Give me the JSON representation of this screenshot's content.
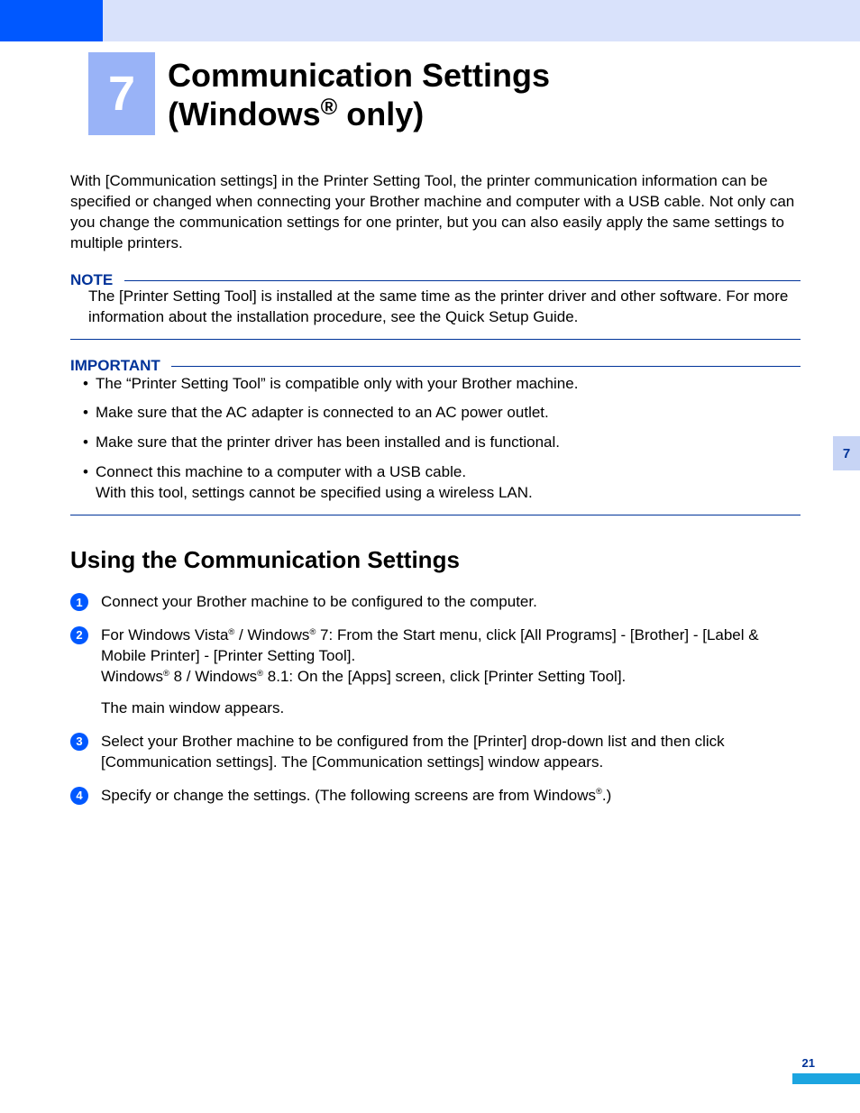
{
  "chapter": {
    "number": "7",
    "title_line1": "Communication Settings",
    "title_line2_a": "(Windows",
    "title_line2_b": " only)"
  },
  "intro": "With [Communication settings] in the Printer Setting Tool, the printer communication information can be specified or changed when connecting your Brother machine and computer with a USB cable. Not only can you change the communication settings for one printer, but you can also easily apply the same settings to multiple printers.",
  "note": {
    "label": "NOTE",
    "body": "The [Printer Setting Tool] is installed at the same time as the printer driver and other software. For more information about the installation procedure, see the Quick Setup Guide."
  },
  "important": {
    "label": "IMPORTANT",
    "items": [
      "The “Printer Setting Tool” is compatible only with your Brother machine.",
      "Make sure that the AC adapter is connected to an AC power outlet.",
      "Make sure that the printer driver has been installed and is functional.",
      "Connect this machine to a computer with a USB cable.\nWith this tool, settings cannot be specified using a wireless LAN."
    ]
  },
  "section": {
    "title": "Using the Communication Settings",
    "steps": {
      "s1": "Connect your Brother machine to be configured to the computer.",
      "s2a": "For Windows Vista",
      "s2b": " / Windows",
      "s2c": " 7: From the Start menu, click [All Programs] - [Brother] - [Label & Mobile Printer] - [Printer Setting Tool].",
      "s2d": "Windows",
      "s2e": " 8 / Windows",
      "s2f": " 8.1: On the [Apps] screen, click [Printer Setting Tool].",
      "s2g": "The main window appears.",
      "s3": "Select your Brother machine to be configured from the [Printer] drop-down list and then click [Communication settings]. The [Communication settings] window appears.",
      "s4a": "Specify or change the settings. (The following screens are from Windows",
      "s4b": ".)"
    }
  },
  "sideTab": "7",
  "pageNumber": "21",
  "reg": "®"
}
